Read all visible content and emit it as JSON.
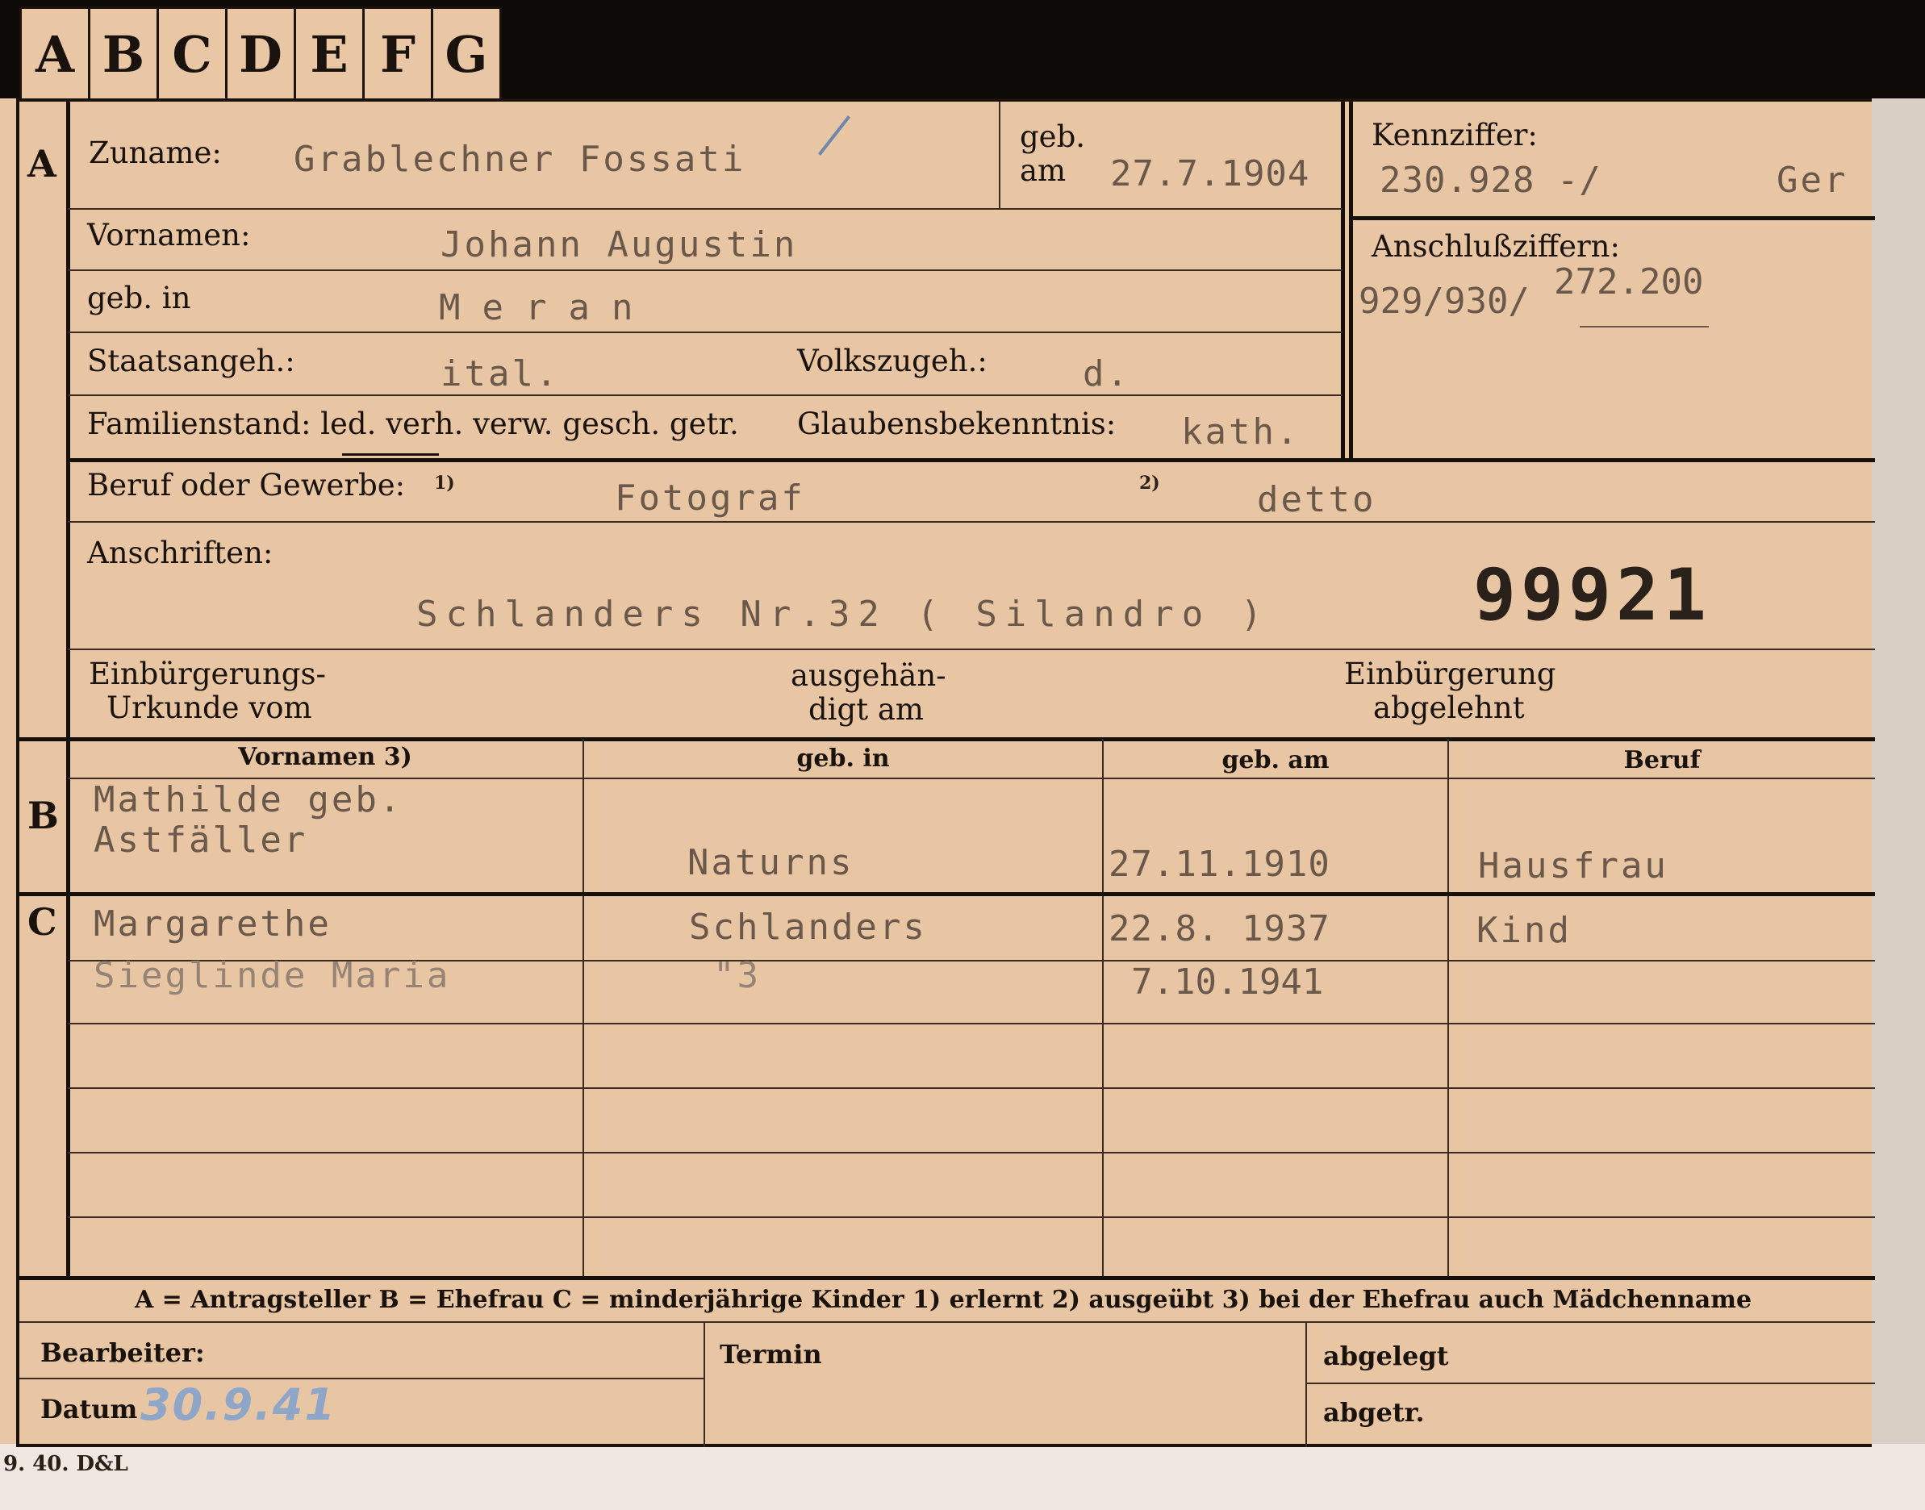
{
  "tabs": [
    "A",
    "B",
    "C",
    "D",
    "E",
    "F",
    "G"
  ],
  "sections": {
    "a": "A",
    "b": "B",
    "c": "C"
  },
  "applicant": {
    "surname_label": "Zuname:",
    "surname": "Grablechner  Fossati",
    "born_label_1": "geb.",
    "born_label_2": "am",
    "born_date": "27.7.1904",
    "firstnames_label": "Vornamen:",
    "firstnames": "Johann Augustin",
    "birthplace_label": "geb. in",
    "birthplace": "Meran",
    "citizenship_label": "Staatsangeh.:",
    "citizenship": "ital.",
    "ethnicity_label": "Volkszugeh.:",
    "ethnicity": "d.",
    "marital_label": "Familienstand: led. verh. verw. gesch. getr.",
    "religion_label": "Glaubensbekenntnis:",
    "religion": "kath.",
    "profession_label": "Beruf oder Gewerbe:",
    "fn1": "1)",
    "fn2": "2)",
    "profession_learned": "Fotograf",
    "profession_practiced": "detto",
    "address_label": "Anschriften:",
    "address": "Schlanders Nr.32 ( Silandro )",
    "card_number": "99921",
    "naturalization_doc_label_1": "Einbürgerungs-",
    "naturalization_doc_label_2": "Urkunde vom",
    "handed_out_label_1": "ausgehän-",
    "handed_out_label_2": "digt am",
    "naturalization_refused_label_1": "Einbürgerung",
    "naturalization_refused_label_2": "abgelehnt"
  },
  "reference": {
    "code_label": "Kennziffer:",
    "code": "230.928 -/",
    "code_suffix": "Ger",
    "linked_label": "Anschlußziffern:",
    "linked_1": "929/930/",
    "linked_2": "272.200"
  },
  "table": {
    "headers": [
      "Vornamen 3)",
      "geb. in",
      "geb. am",
      "Beruf"
    ],
    "wife": {
      "name_line1": "Mathilde geb.",
      "name_line2": "Astfäller",
      "birthplace": "Naturns",
      "born": "27.11.1910",
      "profession": "Hausfrau"
    },
    "children": [
      {
        "name": "Margarethe",
        "birthplace": "Schlanders",
        "born": "22.8. 1937",
        "profession": "Kind"
      },
      {
        "name": "Sieglinde Maria",
        "birthplace": "\"3",
        "born": "7.10.1941",
        "profession": ""
      }
    ]
  },
  "legend": "A = Antragsteller   B = Ehefrau   C = minderjährige Kinder   1) erlernt   2) ausgeübt   3) bei der Ehefrau auch Mädchenname",
  "footer": {
    "clerk_label": "Bearbeiter:",
    "date_label": "Datum",
    "date_value": "30.9.41",
    "deadline_label": "Termin",
    "filed_label": "abgelegt",
    "sent_label": "abgetr."
  },
  "print_code": "9. 40. D&L"
}
